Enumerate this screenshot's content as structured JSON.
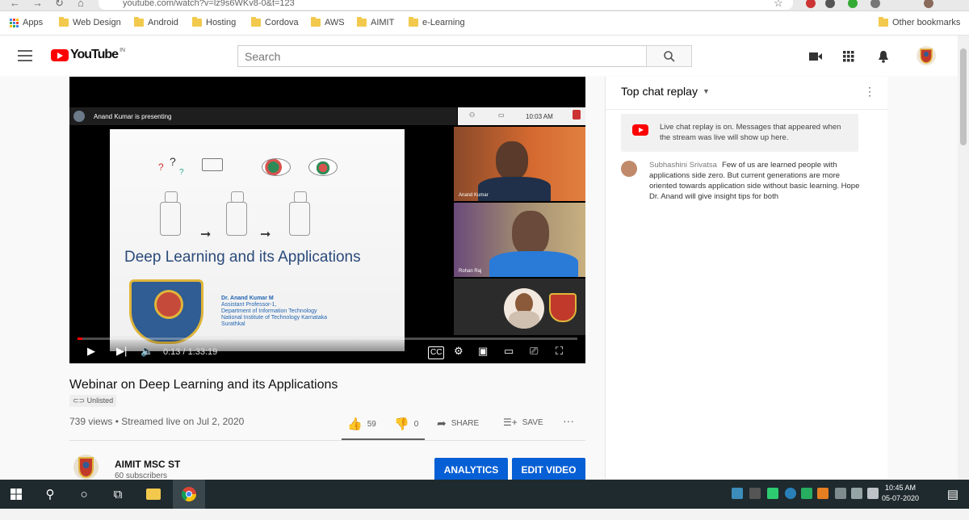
{
  "browser": {
    "url": "youtube.com/watch?v=lz9s6WKv8-0&t=123",
    "bookmarks": [
      {
        "label": "Apps",
        "type": "apps"
      },
      {
        "label": "Web Design",
        "type": "folder"
      },
      {
        "label": "Android",
        "type": "folder"
      },
      {
        "label": "Hosting",
        "type": "folder"
      },
      {
        "label": "Cordova",
        "type": "folder"
      },
      {
        "label": "AWS",
        "type": "folder"
      },
      {
        "label": "AIMIT",
        "type": "folder"
      },
      {
        "label": "e-Learning",
        "type": "folder"
      }
    ],
    "other_bookmarks": "Other bookmarks"
  },
  "header": {
    "logo_text": "YouTube",
    "logo_suffix": "IN",
    "search_placeholder": "Search",
    "icons": [
      "menu-icon",
      "create-video-icon",
      "apps-icon",
      "notifications-icon",
      "account-avatar"
    ]
  },
  "player": {
    "presenting": "Anand Kumar is presenting",
    "meet_time": "10:03 AM",
    "slide": {
      "title": "Deep Learning and its Applications",
      "author_lines": [
        "Dr. Anand Kumar M",
        "Assistant Professor-1,",
        "Department of Information Technology",
        "National Institute of Technology Karnataka",
        "Surathkal"
      ]
    },
    "participants": [
      "Anand Kumar",
      "Rohan Raj",
      ""
    ],
    "time_display": "0:13 / 1:33:19",
    "progress": 0.002,
    "icons": [
      "play-icon",
      "next-icon",
      "volume-icon",
      "subtitles-icon",
      "settings-icon",
      "miniplayer-icon",
      "theater-icon",
      "cast-icon",
      "fullscreen-icon"
    ]
  },
  "video": {
    "title": "Webinar on Deep Learning and its Applications",
    "visibility": "Unlisted",
    "stats": "739 views • Streamed live on Jul 2, 2020",
    "likes": "59",
    "dislikes": "0",
    "share": "SHARE",
    "save": "SAVE",
    "more": "···",
    "channel_name": "AIMIT MSC ST",
    "subscribers": "60 subscribers",
    "analytics_button": "ANALYTICS",
    "edit_button": "EDIT VIDEO"
  },
  "chat": {
    "header": "Top chat replay",
    "notice": "Live chat replay is on. Messages that appeared when the stream was live will show up here.",
    "messages": [
      {
        "author": "Subhashini Srivatsa",
        "text": "Few of us are learned people with applications side zero. But current generations are more oriented towards application side without basic learning. Hope Dr. Anand will give insight tips for both"
      }
    ]
  },
  "taskbar": {
    "time": "10:45 AM",
    "date": "05-07-2020"
  },
  "colors": {
    "youtube_red": "#ff0000",
    "button_blue": "#065fd4",
    "taskbar": "#1f2a2e"
  }
}
